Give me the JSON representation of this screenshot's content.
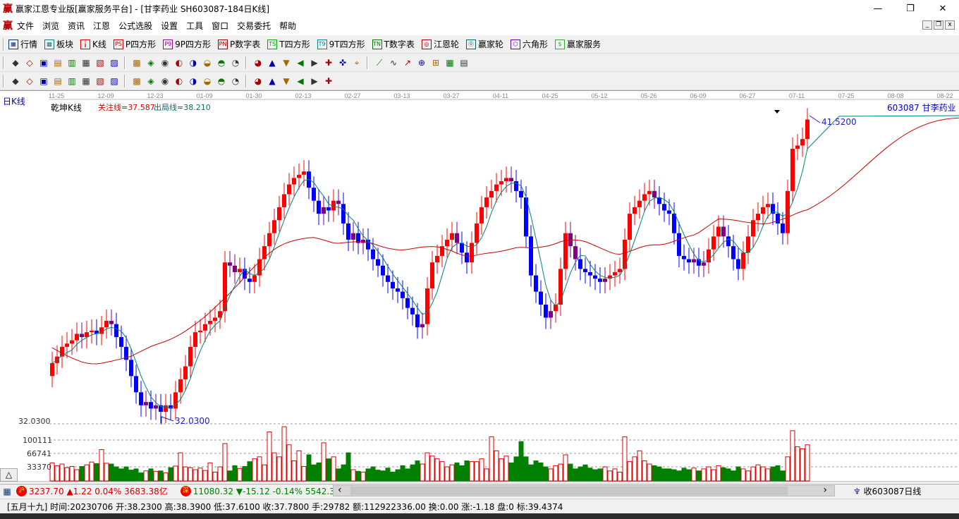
{
  "titlebar": {
    "logo": "赢",
    "title": "赢家江恩专业版[赢家服务平台] - [甘李药业  SH603087-184日K线]",
    "minimize": "—",
    "maximize": "❐",
    "close": "✕"
  },
  "menubar": {
    "logo": "赢",
    "items": [
      "文件",
      "浏览",
      "资讯",
      "江恩",
      "公式选股",
      "设置",
      "工具",
      "窗口",
      "交易委托",
      "帮助"
    ]
  },
  "toolbar1": [
    {
      "icon": "quote-table-icon",
      "glyph": "▦",
      "label": "行情",
      "color": "#0b3a7a"
    },
    {
      "icon": "sector-blocks-icon",
      "glyph": "▩",
      "label": "板块",
      "color": "#1a7a7a"
    },
    {
      "icon": "kline-icon",
      "glyph": "╽",
      "label": "K线",
      "color": "#d00"
    },
    {
      "icon": "ps-icon",
      "glyph": "PS",
      "label": "P四方形",
      "color": "#c00"
    },
    {
      "icon": "p9-icon",
      "glyph": "P9",
      "label": "9P四方形",
      "color": "#909"
    },
    {
      "icon": "pn-icon",
      "glyph": "PN",
      "label": "P数字表",
      "color": "#900"
    },
    {
      "icon": "ts-icon",
      "glyph": "TS",
      "label": "T四方形",
      "color": "#0a0"
    },
    {
      "icon": "t9-icon",
      "glyph": "T9",
      "label": "9T四方形",
      "color": "#088"
    },
    {
      "icon": "tn-icon",
      "glyph": "TN",
      "label": "T数字表",
      "color": "#070"
    },
    {
      "icon": "gann-wheel-icon",
      "glyph": "◎",
      "label": "江恩轮",
      "color": "#a00"
    },
    {
      "icon": "big-wheel-icon",
      "glyph": "⓪",
      "label": "赢家轮",
      "color": "#066"
    },
    {
      "icon": "hexagon-icon",
      "glyph": "⬡",
      "label": "六角形",
      "color": "#60a"
    },
    {
      "icon": "dollar-icon",
      "glyph": "$",
      "label": "赢家服务",
      "color": "#3a3"
    }
  ],
  "toolbar2": [
    "period-icon",
    "pick-icon",
    "doc-icon",
    "multi-chart-icon",
    "bar-chart-icon",
    "grid-icon",
    "line-chart-icon",
    "rect-icon",
    "pick-stock-icon",
    "triangle-icon",
    "first-icon",
    "last-icon",
    "prev-icon",
    "next-icon",
    "up-diamond-icon",
    "down-diamond-icon",
    "expand-diamond-icon",
    "shrink-diamond-icon",
    "left-diamond-icon",
    "right-diamond-icon",
    "hand-icon",
    "crosshair-icon",
    "trend-icon",
    "tool-icon",
    "grid2-icon",
    "calendar-icon",
    "calc-icon",
    "list-icon",
    "print-icon",
    "camera-icon",
    "help-icon"
  ],
  "toolbar3": [
    "line-tool-icon",
    "parallel-icon",
    "fan-icon",
    "arc-icon",
    "gann-box-icon",
    "angle-icon",
    "rect-tool-icon",
    "grid-tool-icon",
    "channel-icon",
    "ruler-icon",
    "percent-icon",
    "fib-icon",
    "fib-time-icon",
    "wave-icon",
    "cycle-icon",
    "spiral-icon",
    "gann-fan-icon",
    "arrow-icon",
    "text-tool-icon",
    "erase-icon",
    "color-icon",
    "infinity-icon"
  ],
  "chart": {
    "period_label": "日K线",
    "indicator": "乾坤K线",
    "focus_line": "关注线=37.587",
    "exit_line": "出局线=38.210",
    "stock": "603087 甘李药业",
    "high_mark": "41.5200",
    "low_mark": "32.0300",
    "price_axis_label": "32.0300",
    "volume_ticks": [
      "100111",
      "66741",
      "33370"
    ],
    "collapse_button": "△"
  },
  "chart_data": {
    "type": "candlestick",
    "x_ticks": [
      "11-25",
      "12-09",
      "12-23",
      "01-09",
      "01-30",
      "02-13",
      "02-27",
      "03-13",
      "03-27",
      "04-11",
      "04-25",
      "05-12",
      "05-26",
      "06-09",
      "06-27",
      "07-11",
      "07-25",
      "08-08",
      "08-22"
    ],
    "price_range": [
      32.03,
      41.52
    ],
    "first_open": 33.5,
    "closes": [
      33.9,
      34.1,
      34.4,
      34.5,
      34.6,
      34.8,
      34.7,
      34.85,
      34.9,
      34.8,
      35.0,
      35.2,
      35.1,
      34.7,
      34.4,
      34.0,
      33.5,
      33.0,
      32.6,
      32.7,
      32.5,
      32.6,
      32.4,
      32.6,
      32.5,
      33.0,
      33.4,
      33.8,
      34.4,
      34.85,
      34.9,
      35.1,
      35.2,
      35.3,
      35.5,
      37.0,
      36.9,
      36.7,
      36.8,
      36.5,
      36.4,
      36.6,
      37.1,
      37.5,
      37.9,
      38.3,
      38.7,
      39.1,
      39.4,
      39.6,
      39.7,
      39.8,
      39.3,
      38.9,
      38.5,
      38.7,
      38.6,
      38.9,
      38.8,
      38.2,
      37.7,
      37.9,
      37.6,
      37.7,
      37.4,
      37.1,
      36.9,
      36.6,
      36.4,
      36.2,
      36.1,
      35.9,
      35.6,
      35.4,
      35.0,
      35.1,
      36.2,
      37.0,
      37.2,
      37.5,
      37.7,
      37.9,
      37.6,
      37.3,
      37.0,
      37.6,
      38.2,
      38.7,
      39.0,
      39.2,
      39.4,
      39.5,
      39.6,
      39.5,
      39.2,
      39.0,
      37.8,
      36.6,
      36.1,
      35.7,
      35.3,
      35.5,
      35.7,
      36.8,
      37.9,
      37.5,
      37.1,
      36.8,
      36.7,
      36.6,
      36.5,
      36.4,
      36.5,
      36.6,
      36.7,
      36.8,
      37.7,
      38.5,
      38.7,
      38.9,
      39.1,
      39.2,
      39.0,
      38.8,
      38.6,
      38.5,
      37.9,
      37.2,
      37.1,
      37.0,
      37.1,
      36.9,
      37.0,
      37.4,
      37.8,
      38.1,
      37.8,
      37.5,
      37.1,
      36.8,
      37.3,
      37.8,
      38.3,
      38.5,
      38.7,
      38.8,
      38.5,
      38.2,
      37.9,
      39.2,
      40.5,
      40.6,
      40.8,
      41.4
    ],
    "volumes": [
      45000,
      38000,
      42000,
      33000,
      36000,
      28000,
      36000,
      40000,
      47000,
      43000,
      78000,
      44000,
      42000,
      35000,
      30000,
      35000,
      27000,
      30000,
      20000,
      25000,
      30000,
      24000,
      25000,
      20000,
      33000,
      37000,
      70000,
      35000,
      33000,
      28000,
      32000,
      26000,
      45000,
      22000,
      35000,
      93000,
      25000,
      38000,
      31000,
      36000,
      48000,
      55000,
      60000,
      40000,
      122000,
      70000,
      60000,
      135000,
      90000,
      50000,
      75000,
      36000,
      65000,
      40000,
      45000,
      95000,
      55000,
      60000,
      30000,
      40000,
      70000,
      28000,
      24000,
      22000,
      30000,
      35000,
      27000,
      25000,
      32000,
      22000,
      28000,
      38000,
      30000,
      40000,
      50000,
      42000,
      70000,
      62000,
      55000,
      48000,
      35000,
      40000,
      45000,
      38000,
      50000,
      48000,
      48000,
      55000,
      30000,
      110000,
      75000,
      55000,
      62000,
      45000,
      60000,
      98000,
      60000,
      40000,
      50000,
      45000,
      35000,
      30000,
      38000,
      42000,
      65000,
      42000,
      30000,
      35000,
      40000,
      32000,
      28000,
      30000,
      35000,
      25000,
      30000,
      22000,
      110000,
      48000,
      60000,
      75000,
      50000,
      42000,
      38000,
      35000,
      30000,
      30000,
      28000,
      25000,
      32000,
      28000,
      32000,
      25000,
      30000,
      35000,
      28000,
      38000,
      33000,
      30000,
      25000,
      35000,
      30000,
      25000,
      35000,
      40000,
      35000,
      30000,
      35000,
      38000,
      25000,
      60000,
      125000,
      85000,
      80000,
      90000
    ],
    "volume_range": [
      0,
      135000
    ],
    "colors": {
      "up": "#ff0000",
      "down": "#0000ff",
      "neutral": "#800080",
      "vol_up": "#dd0000",
      "vol_down": "#008000",
      "ma_short": "#008080",
      "ma_long": "#cc0000"
    }
  },
  "status1": {
    "sh_badge": "沪",
    "sh_text": "3237.70 ▲1.22 0.04% 3683.38亿",
    "sz_badge": "深",
    "sz_text": "11080.32 ▼-15.12 -0.14% 5542.38",
    "scroll_left": "‹",
    "scroll_right": "›",
    "receive": "收603087日线"
  },
  "status2": {
    "text": "[五月十九] 时间:20230706 开:38.2300 高:38.3900 低:37.6100 收:37.7800 手:29782 额:112922336.00 换:0.00 涨:-1.18 盘:0 标:39.4374"
  }
}
